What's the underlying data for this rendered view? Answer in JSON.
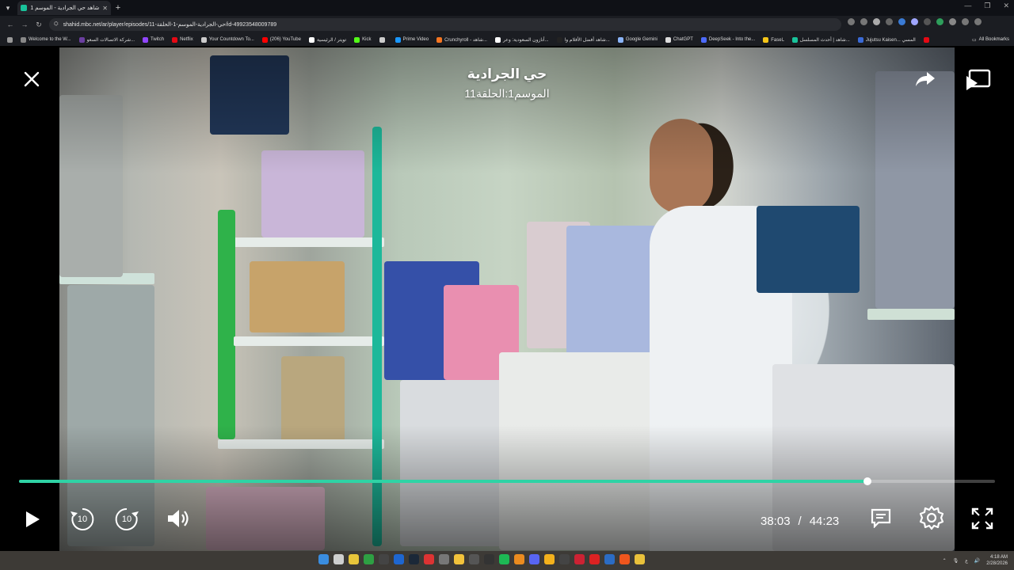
{
  "browser": {
    "tab_title": "شاهد حي الجرادية - الموسم 1 /",
    "url": "shahid.mbc.net/ar/player/episodes/حي-الجرادية-الموسم-1-الحلقة-11/id-49923548009789",
    "bookmarks": [
      {
        "label": "Welcome to the W...",
        "color": "#888"
      },
      {
        "label": "شركة الاتصالات السعو...",
        "color": "#6b3fa0"
      },
      {
        "label": "Twitch",
        "color": "#9146ff"
      },
      {
        "label": "Netflix",
        "color": "#e50914"
      },
      {
        "label": "Your Countdown To...",
        "color": "#cccccc"
      },
      {
        "label": "(206) YouTube",
        "color": "#ff0000"
      },
      {
        "label": "تويتر / الرئيسية",
        "color": "#ffffff"
      },
      {
        "label": "Kick",
        "color": "#53fc18"
      },
      {
        "label": "",
        "color": "#cccccc"
      },
      {
        "label": "Prime Video",
        "color": "#1a98ff"
      },
      {
        "label": "Crunchyroll - شاهد...",
        "color": "#f47521"
      },
      {
        "label": "أنازون السعودية: وعر...",
        "color": "#ffffff"
      },
      {
        "label": "شاهد أفضل الأفلام وا...",
        "color": "#222222"
      },
      {
        "label": "Google Gemini",
        "color": "#8ab4f8"
      },
      {
        "label": "ChatGPT",
        "color": "#dddddd"
      },
      {
        "label": "DeepSeek - Into the...",
        "color": "#4d6bfe"
      },
      {
        "label": "Faselـ",
        "color": "#f5c518"
      },
      {
        "label": "شاهد | أحدث المسلسل...",
        "color": "#19c39b"
      },
      {
        "label": "Jujutsu Kaisen... المسي",
        "color": "#3a6ad6"
      },
      {
        "label": "",
        "color": "#e50914"
      }
    ],
    "all_bookmarks_label": "All Bookmarks"
  },
  "player": {
    "title": "حي الجرادية",
    "subtitle": "الموسم1:الحلقة11",
    "current_time": "38:03",
    "separator": "/",
    "duration": "44:23",
    "progress_fraction": 0.869,
    "accent_color": "#2fd3a5",
    "icons": {
      "close": "close-icon",
      "share": "share-icon",
      "cast": "cast-icon",
      "play": "play-icon",
      "rewind": "rewind-10-icon",
      "forward": "forward-10-icon",
      "volume": "volume-icon",
      "subtitles": "subtitles-icon",
      "settings": "settings-gear-icon",
      "fullscreen": "fullscreen-icon"
    },
    "skip_seconds": "10"
  },
  "taskbar": {
    "time": "4:18 AM",
    "date": "2/28/2026",
    "lang": "ع"
  }
}
